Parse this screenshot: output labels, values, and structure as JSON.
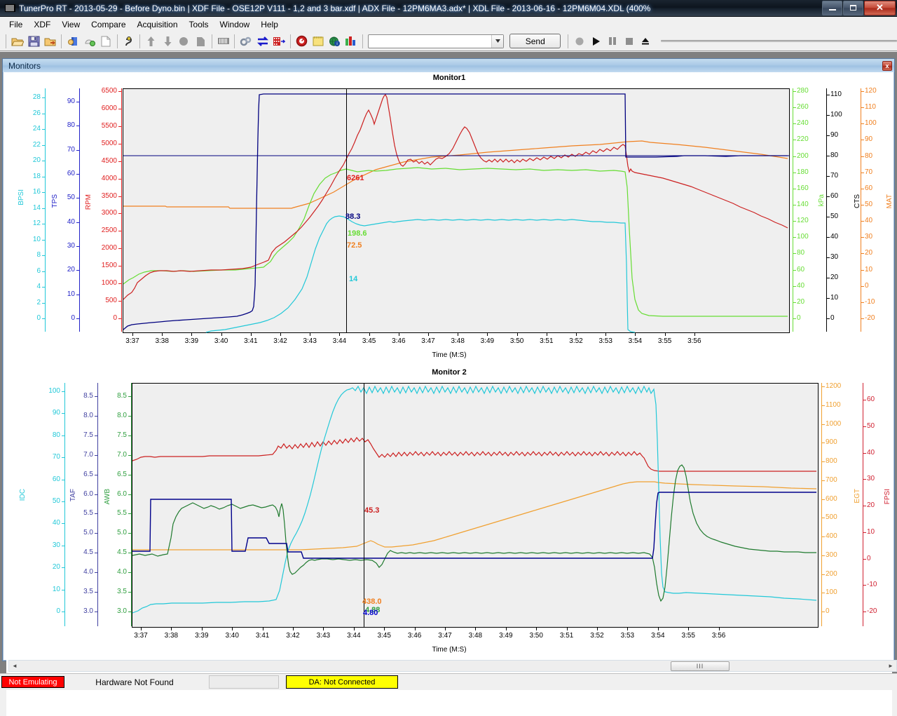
{
  "window": {
    "title": "TunerPro RT - 2013-05-29 - Before Dyno.bin | XDF File - OSE12P V111 - 1,2 and 3 bar.xdf | ADX File - 12PM6MA3.adx* | XDL File - 2013-06-16 - 12PM6M04.XDL (400%",
    "icon": "tunerpro-icon",
    "minimize_label": "",
    "maximize_label": "",
    "close_label": "✕"
  },
  "menu": {
    "items": [
      {
        "label": "File",
        "accel": "F"
      },
      {
        "label": "XDF",
        "accel": "X"
      },
      {
        "label": "View",
        "accel": "V"
      },
      {
        "label": "Compare",
        "accel": "C"
      },
      {
        "label": "Acquisition",
        "accel": "A"
      },
      {
        "label": "Tools",
        "accel": "T"
      },
      {
        "label": "Window",
        "accel": "W"
      },
      {
        "label": "Help",
        "accel": "H"
      }
    ]
  },
  "toolbar": {
    "icons": [
      "open-folder-icon",
      "save-disk-icon",
      "save-as-folder-icon",
      "open-xdf-icon",
      "save-xdf-icon",
      "new-document-icon",
      "worm-tool-icon",
      "upload-arrow-icon",
      "download-arrow-icon",
      "circle-icon",
      "copy-icon",
      "memory-chip-icon",
      "settings-gears-icon",
      "swap-arrows-icon",
      "emulate-icon",
      "gauge-icon",
      "notes-icon",
      "globe-info-icon",
      "bar-chart-icon"
    ],
    "combo_value": "",
    "combo_arrow": "▼",
    "send_label": "Send",
    "transport": [
      "record-icon",
      "play-icon",
      "pause-icon",
      "stop-icon",
      "eject-icon"
    ],
    "slider_value": ""
  },
  "monitor_window": {
    "title": "Monitors",
    "close_label": "x",
    "hscrollbar": {
      "left_arrow": "◄",
      "right_arrow": "►",
      "thumb_label": "III"
    }
  },
  "status_bar": {
    "emulation_status": "Not Emulating",
    "hardware_status": "Hardware Not Found",
    "blank_field": "",
    "da_status": "DA: Not Connected"
  },
  "chart_data": [
    {
      "type": "line",
      "title": "Monitor1",
      "xlabel": "Time (M:S)",
      "x_ticks": [
        "3:37",
        "3:38",
        "3:39",
        "3:40",
        "3:41",
        "3:42",
        "3:43",
        "3:44",
        "3:45",
        "3:46",
        "3:47",
        "3:48",
        "3:49",
        "3:50",
        "3:51",
        "3:52",
        "3:53",
        "3:54",
        "3:55",
        "3:56"
      ],
      "grid": false,
      "legend": "axis-labels",
      "cursor_time": "3:44",
      "left_axes": [
        {
          "name": "BPSI",
          "color": "#22c8d8",
          "min": 0,
          "max": 29,
          "ticks": [
            "28",
            "26",
            "24",
            "22",
            "20",
            "18",
            "16",
            "14",
            "12",
            "10",
            "8",
            "6",
            "4",
            "2",
            "0"
          ]
        },
        {
          "name": "TPS",
          "color": "#2222c8",
          "min": 0,
          "max": 96,
          "ticks": [
            "90",
            "80",
            "70",
            "60",
            "50",
            "40",
            "30",
            "20",
            "10",
            "0"
          ]
        },
        {
          "name": "RPM",
          "color": "#e02020",
          "min": 0,
          "max": 6800,
          "ticks": [
            "6500",
            "6000",
            "5500",
            "5000",
            "4500",
            "4000",
            "3500",
            "3000",
            "2500",
            "2000",
            "1500",
            "1000",
            "500",
            "0"
          ]
        }
      ],
      "right_axes": [
        {
          "name": "kPa",
          "color": "#66dd33",
          "min": 0,
          "max": 292,
          "ticks": [
            "280",
            "260",
            "240",
            "220",
            "200",
            "180",
            "160",
            "140",
            "120",
            "100",
            "80",
            "60",
            "40",
            "20",
            "0"
          ]
        },
        {
          "name": "CTS",
          "color": "#000000",
          "min": 0,
          "max": 114,
          "ticks": [
            "110",
            "100",
            "90",
            "80",
            "70",
            "60",
            "50",
            "40",
            "30",
            "20",
            "10",
            "0"
          ]
        },
        {
          "name": "MAT",
          "color": "#f08020",
          "min": -20,
          "max": 124,
          "ticks": [
            "120",
            "110",
            "100",
            "90",
            "80",
            "70",
            "60",
            "50",
            "40",
            "30",
            "20",
            "10",
            "0",
            "-10",
            "-20"
          ]
        }
      ],
      "cursor_readouts": [
        {
          "series": "RPM",
          "value": "6261",
          "color": "#e02020"
        },
        {
          "series": "TPS",
          "value": "88.3",
          "color": "#00007f"
        },
        {
          "series": "kPa",
          "value": "198.6",
          "color": "#66dd33"
        },
        {
          "series": "MAT",
          "value": "72.5",
          "color": "#f08020"
        },
        {
          "series": "BPSI",
          "value": "14",
          "color": "#22c8d8"
        }
      ],
      "series": [
        {
          "name": "RPM",
          "color": "#cc2020",
          "axis": "RPM"
        },
        {
          "name": "TPS",
          "color": "#00007f",
          "axis": "TPS"
        },
        {
          "name": "kPa",
          "color": "#66dd33",
          "axis": "kPa"
        },
        {
          "name": "MAT",
          "color": "#f08020",
          "axis": "MAT"
        },
        {
          "name": "BPSI",
          "color": "#22c8d8",
          "axis": "BPSI"
        }
      ]
    },
    {
      "type": "line",
      "title": "Monitor 2",
      "xlabel": "Time (M:S)",
      "x_ticks": [
        "3:37",
        "3:38",
        "3:39",
        "3:40",
        "3:41",
        "3:42",
        "3:43",
        "3:44",
        "3:45",
        "3:46",
        "3:47",
        "3:48",
        "3:49",
        "3:50",
        "3:51",
        "3:52",
        "3:53",
        "3:54",
        "3:55",
        "3:56"
      ],
      "grid": false,
      "legend": "axis-labels",
      "cursor_time": "3:44",
      "left_axes": [
        {
          "name": "IDC",
          "color": "#22c8d8",
          "min": 0,
          "max": 104,
          "ticks": [
            "100",
            "90",
            "80",
            "70",
            "60",
            "50",
            "40",
            "30",
            "20",
            "10",
            "0"
          ]
        },
        {
          "name": "TAF",
          "color": "#4040a0",
          "min": 3.0,
          "max": 8.7,
          "ticks": [
            "8.5",
            "8.0",
            "7.5",
            "7.0",
            "6.5",
            "6.0",
            "5.5",
            "5.0",
            "4.5",
            "4.0",
            "3.5",
            "3.0"
          ]
        },
        {
          "name": "AWB",
          "color": "#2e9e3e",
          "min": 3.0,
          "max": 8.7,
          "ticks": [
            "8.5",
            "8.0",
            "7.5",
            "7.0",
            "6.5",
            "6.0",
            "5.5",
            "5.0",
            "4.5",
            "4.0",
            "3.5",
            "3.0"
          ]
        }
      ],
      "right_axes": [
        {
          "name": "EGT",
          "color": "#f0a030",
          "min": 0,
          "max": 1250,
          "ticks": [
            "1200",
            "1100",
            "1000",
            "900",
            "800",
            "700",
            "600",
            "500",
            "400",
            "300",
            "200",
            "100",
            "0"
          ]
        },
        {
          "name": "FPSI",
          "color": "#d02030",
          "min": -20,
          "max": 65,
          "ticks": [
            "60",
            "50",
            "40",
            "30",
            "20",
            "10",
            "0",
            "-10",
            "-20"
          ]
        }
      ],
      "cursor_readouts": [
        {
          "series": "FPSI",
          "value": "45.3",
          "color": "#cc2020"
        },
        {
          "series": "EGT",
          "value": "438.0",
          "color": "#f08020"
        },
        {
          "series": "AWB",
          "value": "4.88",
          "color": "#2e9e3e"
        },
        {
          "series": "TAF",
          "value": "4.80",
          "color": "#0000cc"
        }
      ],
      "series": [
        {
          "name": "FPSI",
          "color": "#cc2020",
          "axis": "FPSI"
        },
        {
          "name": "EGT",
          "color": "#f0a030",
          "axis": "EGT"
        },
        {
          "name": "AWB",
          "color": "#1f7a2e",
          "axis": "AWB"
        },
        {
          "name": "TAF",
          "color": "#00008b",
          "axis": "TAF"
        },
        {
          "name": "IDC",
          "color": "#22c8d8",
          "axis": "IDC"
        }
      ]
    }
  ]
}
